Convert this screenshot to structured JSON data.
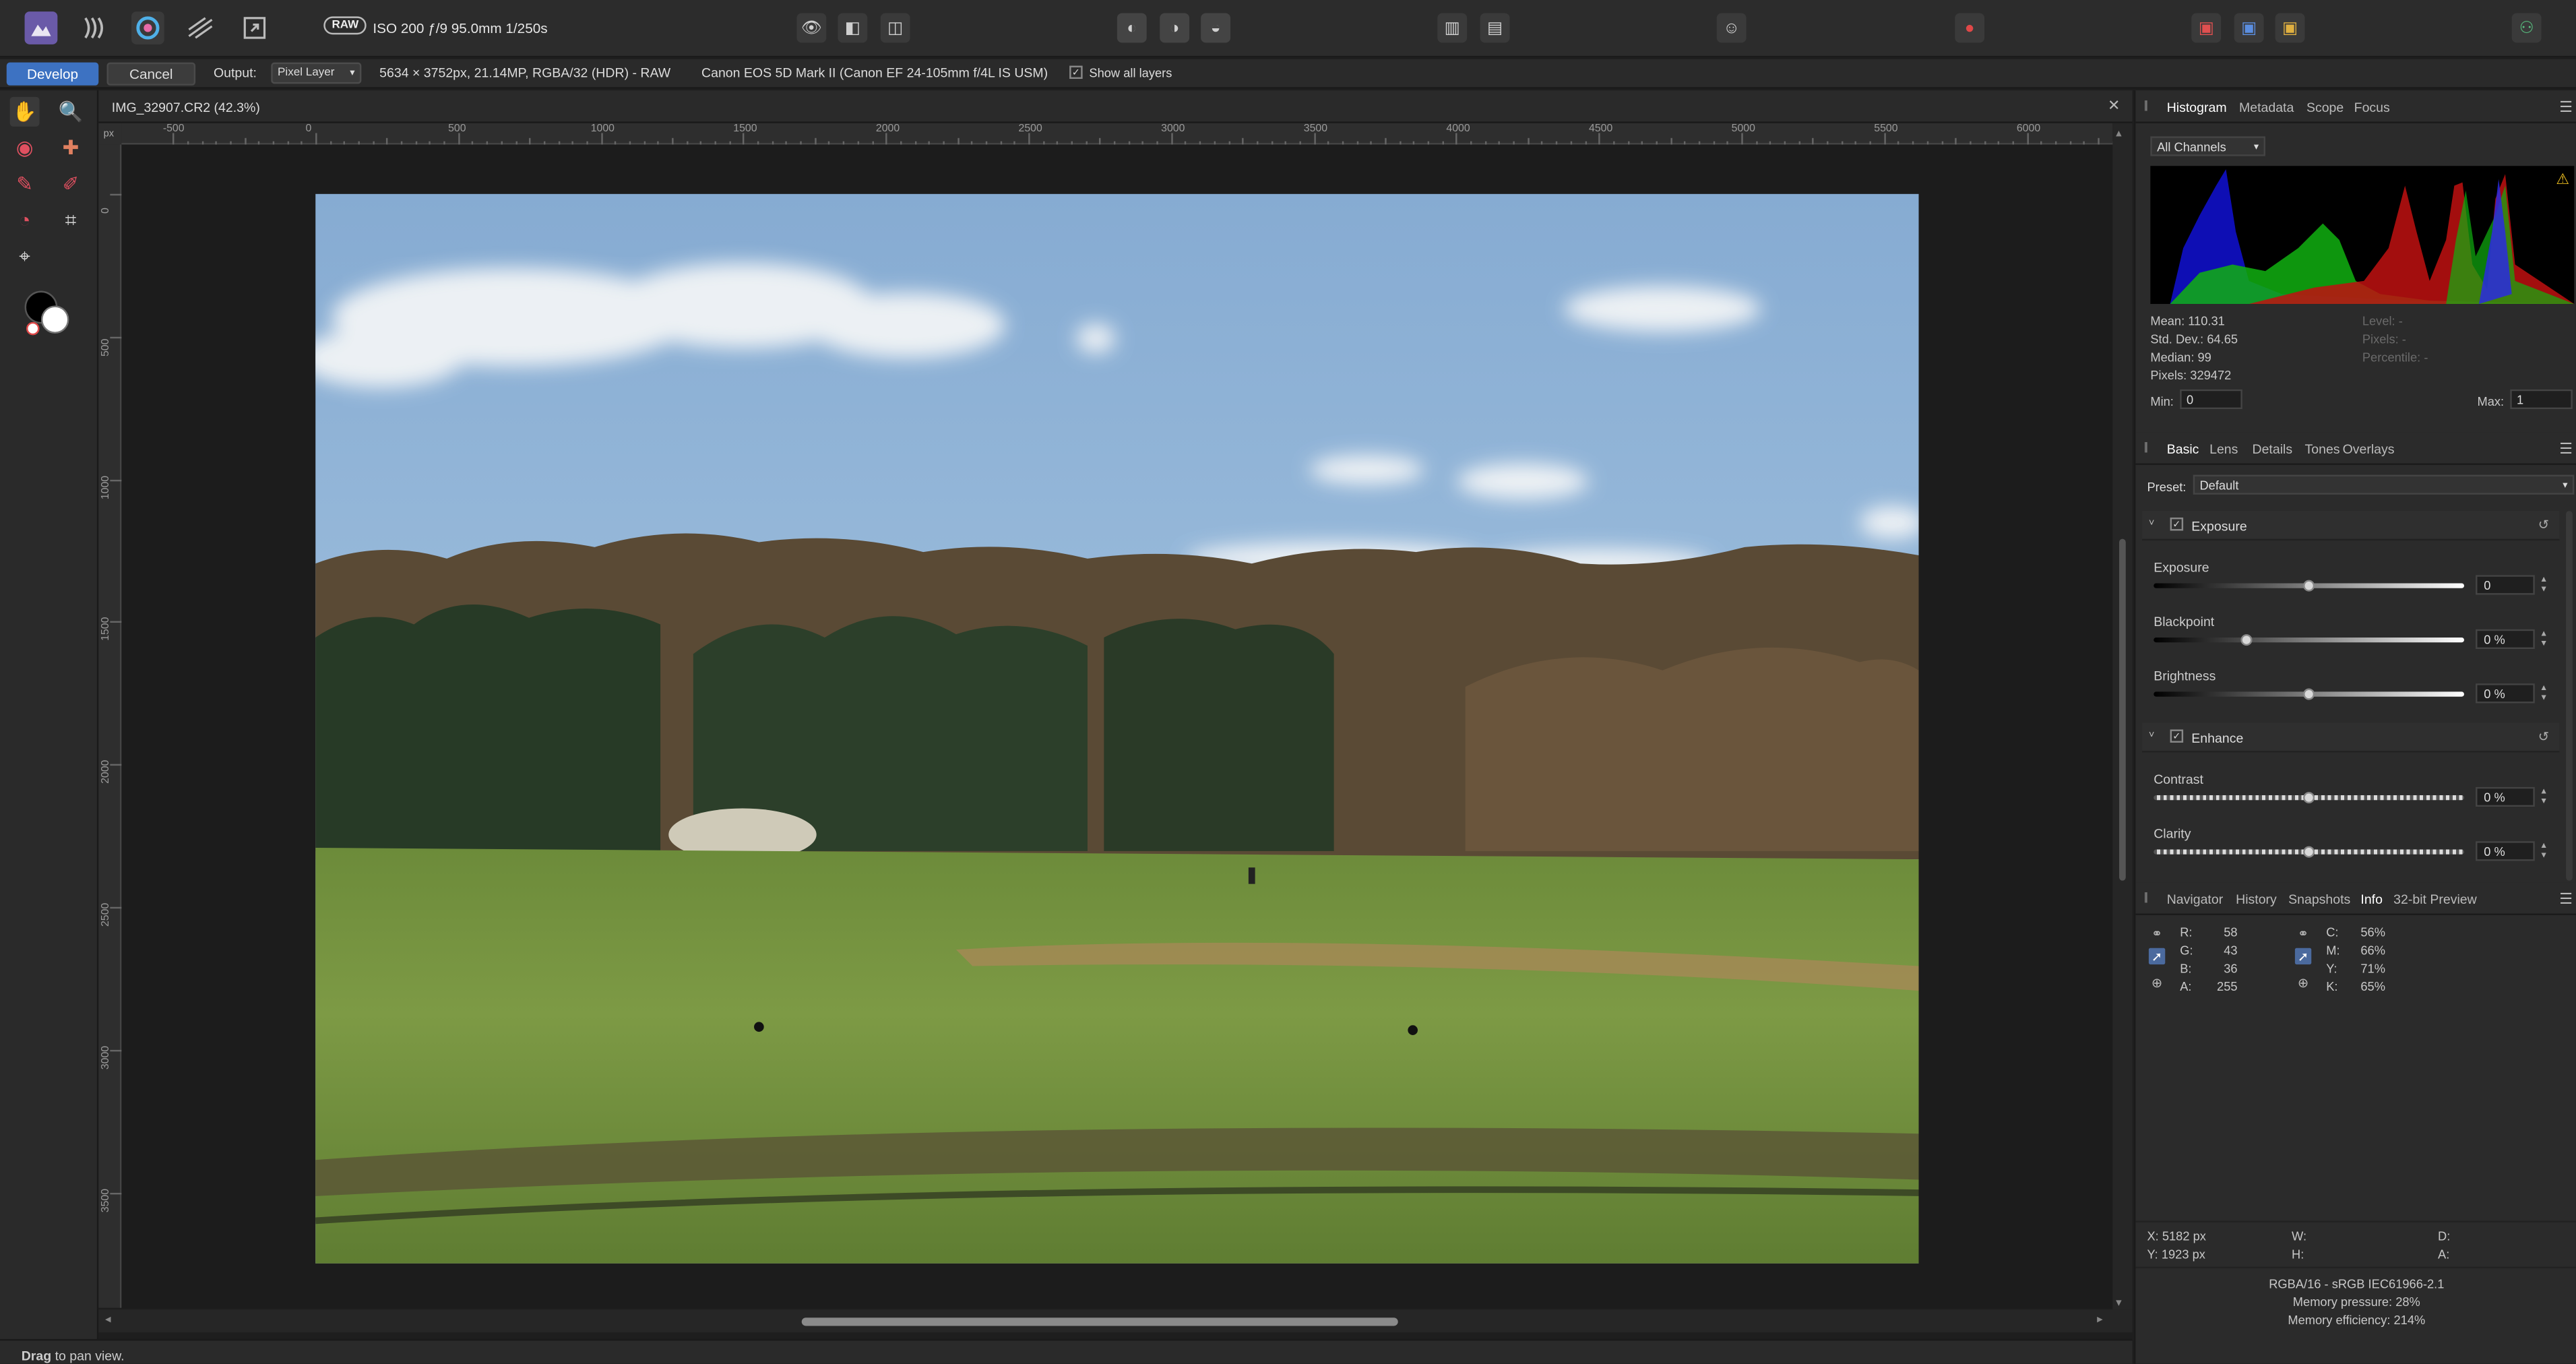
{
  "app": {
    "raw_badge": "RAW",
    "camera_settings": "ISO 200 ƒ/9 95.0mm 1/250s",
    "accent": "#3d72c2"
  },
  "context_bar": {
    "develop_label": "Develop",
    "cancel_label": "Cancel",
    "output_label": "Output:",
    "output_value": "Pixel Layer",
    "image_info": "5634 × 3752px, 21.14MP, RGBA/32 (HDR) - RAW",
    "lens_info": "Canon EOS 5D Mark II (Canon EF 24-105mm f/4L IS USM)",
    "show_all_layers_label": "Show all layers",
    "show_all_layers_checked": true
  },
  "document": {
    "title": "IMG_32907.CR2 (42.3%)",
    "ruler_unit": "px",
    "ruler_h": [
      "-500",
      "0",
      "500",
      "1000",
      "1500",
      "2000",
      "2500",
      "3000",
      "3500",
      "4000",
      "4500",
      "5000",
      "5500",
      "6000"
    ],
    "ruler_v": [
      "0",
      "500",
      "1000",
      "1500",
      "2000",
      "2500",
      "3000",
      "3500"
    ]
  },
  "status": {
    "bold": "Drag",
    "text": " to pan view."
  },
  "histogram_panel": {
    "tabs": [
      "Histogram",
      "Metadata",
      "Scope",
      "Focus"
    ],
    "active_tab": "Histogram",
    "channel": "All Channels",
    "mean": "Mean: 110.31",
    "std_dev": "Std. Dev.: 64.65",
    "median": "Median: 99",
    "pixels": "Pixels: 329472",
    "level": "Level: -",
    "pixels_right": "Pixels: -",
    "percentile": "Percentile: -",
    "min_label": "Min:",
    "min_value": "0",
    "max_label": "Max:",
    "max_value": "1"
  },
  "adjust_panel": {
    "tabs": [
      "Basic",
      "Lens",
      "Details",
      "Tones",
      "Overlays"
    ],
    "active_tab": "Basic",
    "preset_label": "Preset:",
    "preset_value": "Default",
    "exposure_section": "Exposure",
    "exposure_label": "Exposure",
    "exposure_value": "0",
    "exposure_level": 0.5,
    "blackpoint_label": "Blackpoint",
    "blackpoint_value": "0 %",
    "blackpoint_level": 0.3,
    "brightness_label": "Brightness",
    "brightness_value": "0 %",
    "brightness_level": 0.5,
    "enhance_section": "Enhance",
    "contrast_label": "Contrast",
    "contrast_value": "0 %",
    "contrast_level": 0.5,
    "clarity_label": "Clarity",
    "clarity_value": "0 %",
    "clarity_level": 0.5
  },
  "info_panel": {
    "tabs": [
      "Navigator",
      "History",
      "Snapshots",
      "Info",
      "32-bit Preview"
    ],
    "active_tab": "Info",
    "rgba": {
      "r_label": "R:",
      "r": "58",
      "g_label": "G:",
      "g": "43",
      "b_label": "B:",
      "b": "36",
      "a_label": "A:",
      "a": "255"
    },
    "cmyk": {
      "c_label": "C:",
      "c": "56%",
      "m_label": "M:",
      "m": "66%",
      "y_label": "Y:",
      "y": "71%",
      "k_label": "K:",
      "k": "65%"
    },
    "x": "X: 5182 px",
    "y": "Y: 1923 px",
    "w": "W:",
    "h": "H:",
    "d": "D:",
    "a": "A:",
    "color_format": "RGBA/16 - sRGB IEC61966-2.1",
    "memory_pressure": "Memory pressure: 28%",
    "memory_efficiency": "Memory efficiency: 214%"
  }
}
